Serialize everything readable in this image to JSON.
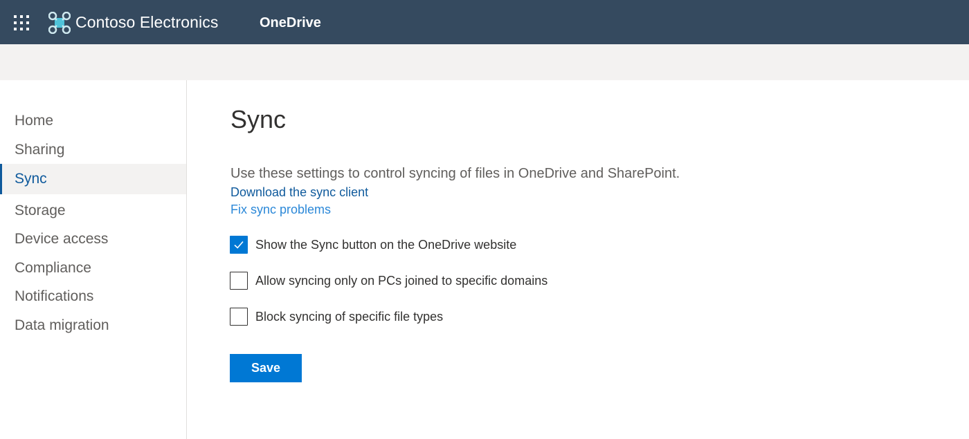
{
  "header": {
    "org_name": "Contoso Electronics",
    "app_name": "OneDrive",
    "background_color": "#354a5f"
  },
  "sidebar": {
    "items": [
      {
        "label": "Home",
        "active": false
      },
      {
        "label": "Sharing",
        "active": false
      },
      {
        "label": "Sync",
        "active": true
      },
      {
        "label": "Storage",
        "active": false
      },
      {
        "label": "Device access",
        "active": false
      },
      {
        "label": "Compliance",
        "active": false
      },
      {
        "label": "Notifications",
        "active": false
      },
      {
        "label": "Data migration",
        "active": false
      }
    ]
  },
  "main": {
    "title": "Sync",
    "description": "Use these settings to control syncing of files in OneDrive and SharePoint.",
    "links": {
      "download": "Download the sync client",
      "fix": "Fix sync problems"
    },
    "options": [
      {
        "label": "Show the Sync button on the OneDrive website",
        "checked": true
      },
      {
        "label": "Allow syncing only on PCs joined to specific domains",
        "checked": false
      },
      {
        "label": "Block syncing of specific file types",
        "checked": false
      }
    ],
    "save_label": "Save"
  },
  "icons": {
    "waffle": "app-launcher-icon",
    "logo": "contoso-logo-icon",
    "check": "checkmark-icon"
  },
  "colors": {
    "accent": "#0078d4",
    "link": "#0f5a9c",
    "link_secondary": "#2b88d8",
    "active_nav_bg": "#f3f2f1"
  }
}
